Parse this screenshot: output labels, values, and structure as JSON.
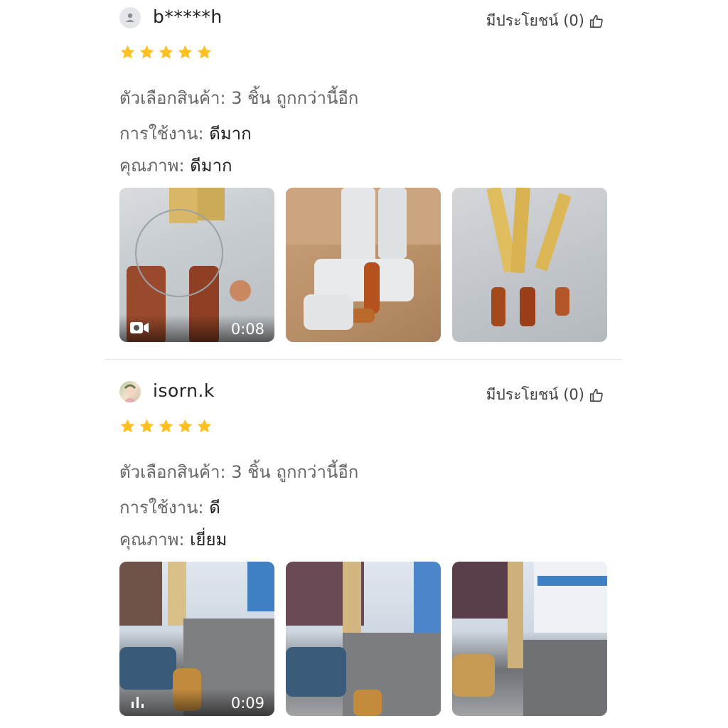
{
  "reviews": [
    {
      "username": "b*****h",
      "avatar": "default-user-avatar",
      "helpful_label": "มีประโยชน์ (0)",
      "rating": 5,
      "variant_label": "ตัวเลือกสินค้า: 3 ชิ้น ถูกกว่านี้อีก",
      "usage_label": "การใช้งาน:",
      "usage_value": "ดีมาก",
      "quality_label": "คุณภาพ:",
      "quality_value": "ดีมาก",
      "media": [
        {
          "type": "video",
          "duration": "0:08",
          "icon": "video-camera-icon"
        },
        {
          "type": "image"
        },
        {
          "type": "image"
        }
      ]
    },
    {
      "username": "isorn.k",
      "avatar": "user-photo-avatar",
      "helpful_label": "มีประโยชน์ (0)",
      "rating": 5,
      "variant_label": "ตัวเลือกสินค้า: 3 ชิ้น ถูกกว่านี้อีก",
      "usage_label": "การใช้งาน:",
      "usage_value": "ดี",
      "quality_label": "คุณภาพ:",
      "quality_value": "เยี่ยม",
      "media": [
        {
          "type": "video",
          "duration": "0:09",
          "icon": "audio-bars-icon"
        },
        {
          "type": "image"
        },
        {
          "type": "image"
        }
      ]
    }
  ],
  "colors": {
    "star": "#FFC021",
    "text_primary": "#222222",
    "text_secondary": "#666666",
    "divider": "#E5E5E5"
  }
}
